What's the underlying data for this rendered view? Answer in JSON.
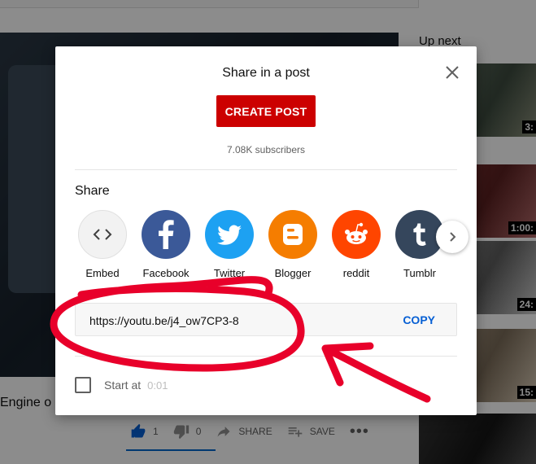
{
  "page": {
    "video_title": "Engine o",
    "upnext_label": "Up next",
    "actions": {
      "like_count": "1",
      "dislike_count": "0",
      "share_label": "SHARE",
      "save_label": "SAVE",
      "more_label": "•••"
    },
    "upnext_durations": [
      "3:",
      "1:00:",
      "24:",
      "15:",
      ""
    ]
  },
  "dialog": {
    "title": "Share in a post",
    "create_post_label": "CREATE POST",
    "subscribers": "7.08K subscribers",
    "share_label": "Share",
    "targets": [
      {
        "name": "Embed",
        "icon": "embed-icon",
        "color": "#f0f0f0"
      },
      {
        "name": "Facebook",
        "icon": "facebook-icon",
        "color": "#3b5998"
      },
      {
        "name": "Twitter",
        "icon": "twitter-icon",
        "color": "#1da1f2"
      },
      {
        "name": "Blogger",
        "icon": "blogger-icon",
        "color": "#f57d00"
      },
      {
        "name": "reddit",
        "icon": "reddit-icon",
        "color": "#ff4500"
      },
      {
        "name": "Tumblr",
        "icon": "tumblr-icon",
        "color": "#35465c"
      }
    ],
    "link_url": "https://youtu.be/j4_ow7CP3-8",
    "copy_label": "COPY",
    "start_at_label": "Start at",
    "start_at_value": "0:01",
    "start_at_checked": false
  },
  "colors": {
    "brand_red": "#cc0000",
    "link_blue": "#065fd4",
    "annotation_red": "#e8002a"
  }
}
